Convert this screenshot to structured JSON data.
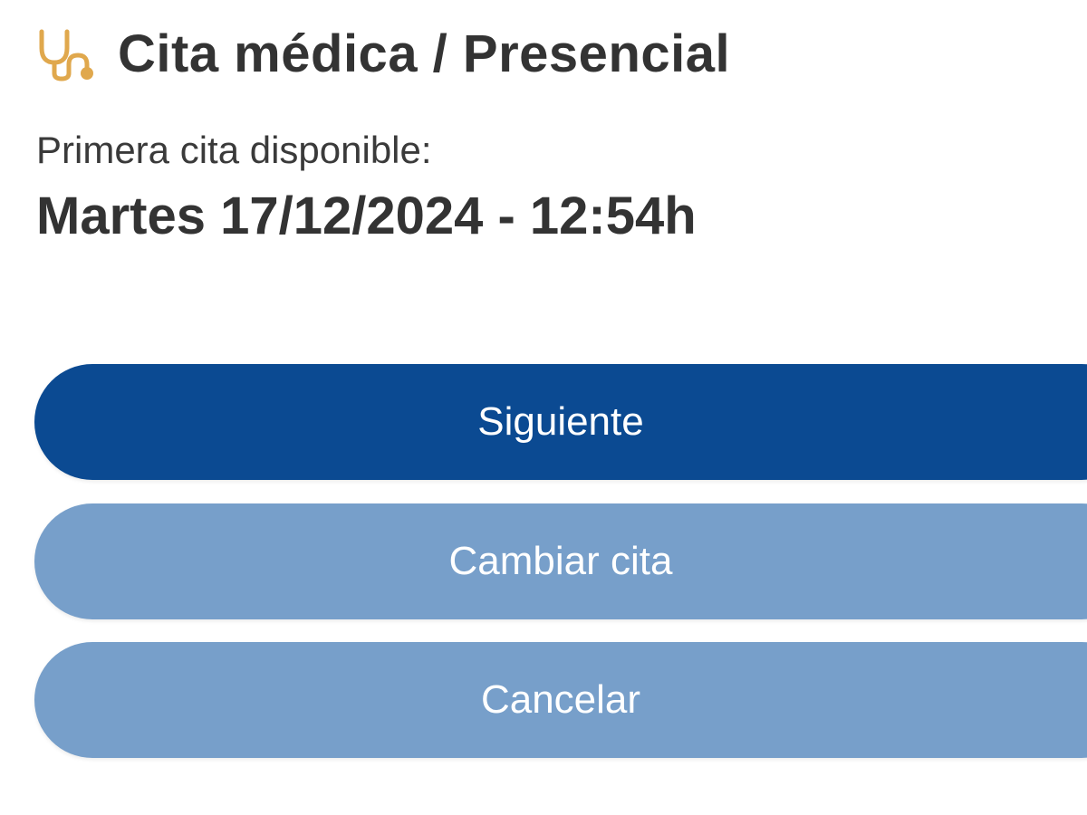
{
  "header": {
    "icon": "stethoscope-icon",
    "icon_color": "#e0a84d",
    "title": "Cita médica / Presencial"
  },
  "appointment": {
    "label": "Primera cita disponible:",
    "datetime": "Martes 17/12/2024 - 12:54h"
  },
  "buttons": {
    "next": "Siguiente",
    "change": "Cambiar cita",
    "cancel": "Cancelar"
  },
  "colors": {
    "primary_button": "#0b4a92",
    "secondary_button": "#779fca",
    "text": "#333333"
  }
}
